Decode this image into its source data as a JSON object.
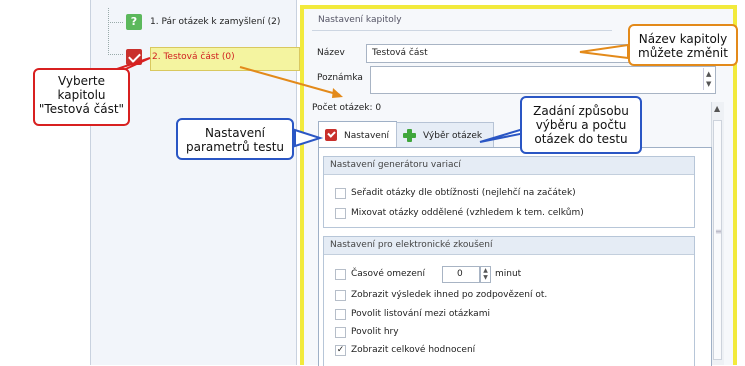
{
  "tree": {
    "items": [
      {
        "label": "1. Pár otázek k zamyšlení (2)",
        "icon": "question-chapter-icon"
      },
      {
        "label": "2. Testová část (0)",
        "icon": "checked-chapter-icon",
        "selected": true
      }
    ]
  },
  "settings": {
    "header": "Nastavení kapitoly",
    "name_label": "Název",
    "name_value": "Testová část",
    "note_label": "Poznámka",
    "note_value": "",
    "question_count": "Počet otázek: 0",
    "tabs": [
      {
        "label": "Nastavení",
        "icon": "checkbox-red-icon",
        "active": true
      },
      {
        "label": "Výběr otázek",
        "icon": "plus-green-icon",
        "active": false
      }
    ],
    "generator_group": {
      "title": "Nastavení generátoru variací",
      "options": [
        {
          "label": "Seřadit otázky dle obtížnosti (nejlehčí na začátek)",
          "checked": false
        },
        {
          "label": "Mixovat otázky oddělené (vzhledem k tem. celkům)",
          "checked": false
        }
      ]
    },
    "exam_group": {
      "title": "Nastavení pro elektronické zkoušení",
      "time_limit_label": "Časové omezení",
      "time_limit_value": "0",
      "time_limit_unit": "minut",
      "options": [
        {
          "label": "Zobrazit výsledek ihned po zodpovězení ot.",
          "checked": false
        },
        {
          "label": "Povolit listování mezi otázkami",
          "checked": false
        },
        {
          "label": "Povolit hry",
          "checked": false
        },
        {
          "label": "Zobrazit celkové hodnocení",
          "checked": true
        }
      ]
    }
  },
  "callouts": {
    "select_chapter": "Vyberte kapitolu \"Testová část\"",
    "test_params": "Nastavení parametrů testu",
    "question_selection": "Zadání způsobu výběru a počtu otázek do testu",
    "rename_chapter": "Název kapitoly můžete změnit"
  },
  "colors": {
    "highlight_border": "#f2ea3c",
    "callout_blue": "#2a56c4",
    "callout_red": "#d82020",
    "callout_orange": "#e38a1a"
  }
}
